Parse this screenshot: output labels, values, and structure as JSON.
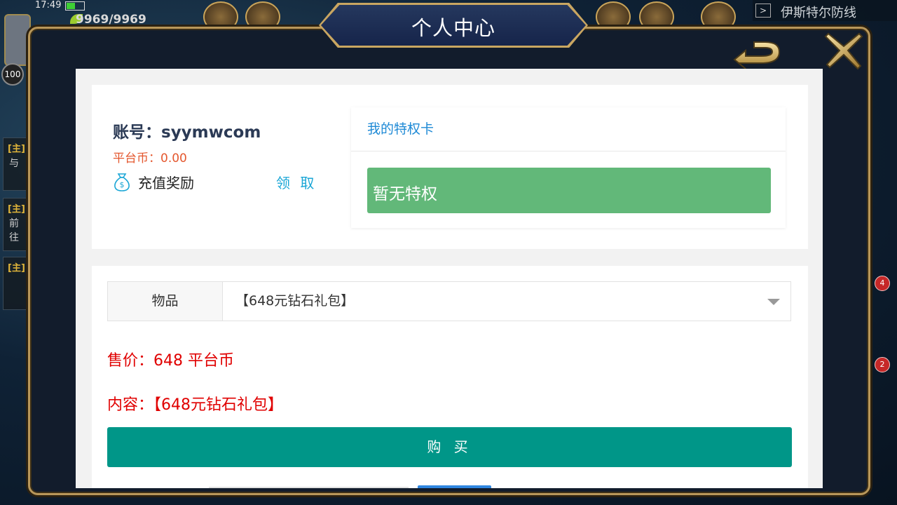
{
  "status": {
    "time": "17:49",
    "energy": "9969/9969"
  },
  "hud": {
    "level": "100",
    "map_name": "伊斯特尔防线",
    "quests": [
      {
        "tag": "[主]",
        "text": "与"
      },
      {
        "tag": "[主]",
        "text": "前往"
      },
      {
        "tag": "[主]",
        "text": ""
      }
    ],
    "badges": [
      "4",
      "2"
    ]
  },
  "dialog": {
    "title": "个人中心",
    "account_label": "账号：syymwcom",
    "coins_label": "平台币：0.00",
    "reward_label": "充值奖励",
    "claim_label": "领 取",
    "privilege": {
      "title": "我的特权卡",
      "empty_text": "暂无特权"
    },
    "purchase": {
      "item_label": "物品",
      "item_value": "【648元钻石礼包】",
      "price_text": "售价：648 平台币",
      "content_text": "内容：【648元钻石礼包】",
      "buy_label": "购 买"
    }
  },
  "colors": {
    "accent_green": "#62b879",
    "buy_teal": "#009688",
    "link_blue": "#1f8ad6",
    "price_red": "#e00000"
  }
}
